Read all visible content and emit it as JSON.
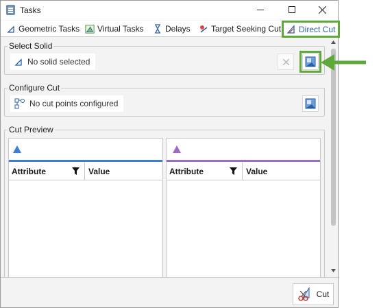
{
  "window": {
    "title": "Tasks"
  },
  "tabs": [
    {
      "label": "Geometric Tasks",
      "icon": "geometric-icon"
    },
    {
      "label": "Virtual Tasks",
      "icon": "virtual-icon"
    },
    {
      "label": "Delays",
      "icon": "hourglass-icon"
    },
    {
      "label": "Target Seeking Cut",
      "icon": "target-seeking-icon"
    },
    {
      "label": "Direct Cut",
      "icon": "direct-cut-icon",
      "active": true
    }
  ],
  "select_solid": {
    "title": "Select Solid",
    "value": "No solid selected"
  },
  "configure_cut": {
    "title": "Configure Cut",
    "value": "No cut points configured"
  },
  "cut_preview": {
    "title": "Cut Preview",
    "panels": [
      {
        "accent": "#3b7dd8",
        "col1": "Attribute",
        "col2": "Value"
      },
      {
        "accent": "#9b6bc6",
        "col1": "Attribute",
        "col2": "Value"
      }
    ]
  },
  "footer": {
    "cut_label": "Cut"
  },
  "colors": {
    "highlight": "#5fa83a",
    "blue_accent": "#3b7dd8",
    "purple_accent": "#9b6bc6"
  }
}
